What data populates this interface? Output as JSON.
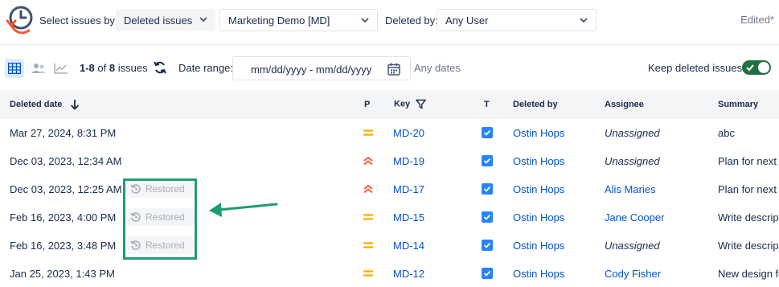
{
  "filters": {
    "select_label": "Select issues by:",
    "select_value": "Deleted issues",
    "project_value": "Marketing Demo [MD]",
    "deleted_by_label": "Deleted by:",
    "deleted_by_value": "Any User",
    "edited": "Edited*"
  },
  "toolbar": {
    "range": "1-8",
    "of": "of",
    "total": "8",
    "issues": "issues",
    "date_range_label": "Date range:",
    "date_range_value": "mm/dd/yyyy - mm/dd/yyyy",
    "any_dates": "Any dates",
    "keep_deleted_label": "Keep deleted issues",
    "keep_deleted_on": true
  },
  "table": {
    "headers": {
      "deleted_date": "Deleted date",
      "p": "P",
      "key": "Key",
      "t": "T",
      "deleted_by": "Deleted by",
      "assignee": "Assignee",
      "summary": "Summary"
    },
    "restored_label": "Restored",
    "rows": [
      {
        "date": "Mar 27, 2024, 8:31 PM",
        "priority": "medium",
        "key": "MD-20",
        "deleted_by": "Ostin Hops",
        "assignee": "Unassigned",
        "summary": "abc"
      },
      {
        "date": "Dec 03, 2023, 12:34 AM",
        "priority": "highest",
        "key": "MD-19",
        "deleted_by": "Ostin Hops",
        "assignee": "Unassigned",
        "summary": "Plan for next r"
      },
      {
        "date": "Dec 03, 2023, 12:25 AM",
        "priority": "highest",
        "key": "MD-17",
        "deleted_by": "Ostin Hops",
        "assignee": "Alis Maries",
        "summary": "Plan for next r"
      },
      {
        "date": "Feb 16, 2023, 4:00 PM",
        "priority": "medium",
        "key": "MD-15",
        "deleted_by": "Ostin Hops",
        "assignee": "Jane Cooper",
        "summary": "Write descript"
      },
      {
        "date": "Feb 16, 2023, 3:48 PM",
        "priority": "medium",
        "key": "MD-14",
        "deleted_by": "Ostin Hops",
        "assignee": "Unassigned",
        "summary": "Write descript"
      },
      {
        "date": "Jan 25, 2023, 1:43 PM",
        "priority": "medium",
        "key": "MD-12",
        "deleted_by": "Ostin Hops",
        "assignee": "Cody Fisher",
        "summary": "New design fo"
      }
    ]
  },
  "colors": {
    "accent": "#0052cc",
    "priority_medium": "#ffab00",
    "priority_highest": "#ff5630",
    "toggle_on": "#1f6f43",
    "highlight": "#1f9d70"
  },
  "icons": {
    "logo": "clock-restore-icon",
    "grid_view": "grid-icon",
    "users_view": "users-icon",
    "chart_view": "chart-icon",
    "refresh": "refresh-icon",
    "calendar": "calendar-icon",
    "sort": "arrow-down-icon",
    "filter": "filter-icon",
    "restore": "restore-icon"
  }
}
